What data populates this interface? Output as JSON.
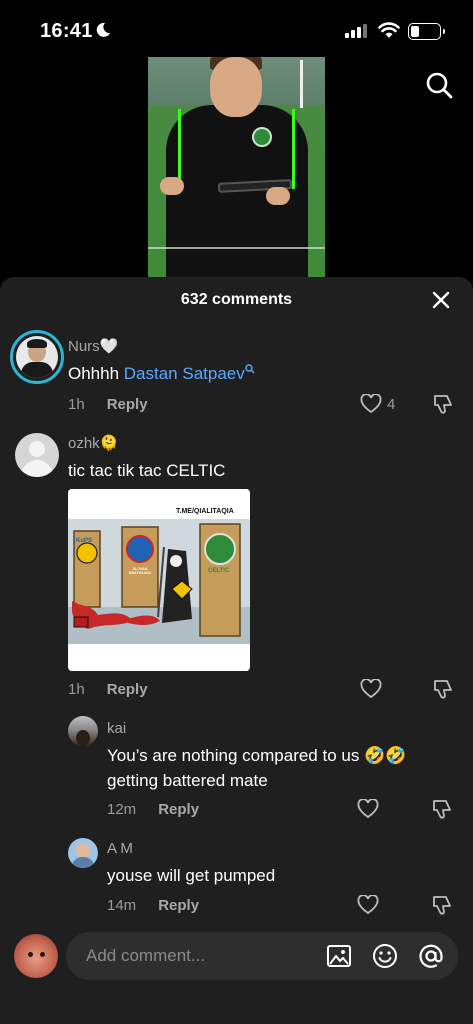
{
  "status_bar": {
    "time": "16:41",
    "battery_level": 0.3
  },
  "video": {
    "search_icon": "search-icon"
  },
  "comments_panel": {
    "title": "632 comments",
    "comments": [
      {
        "user": "Nurs🤍",
        "text_prefix": "Ohhhh ",
        "mention": "Dastan Satpaev",
        "time": "1h",
        "reply_label": "Reply",
        "likes": "4"
      },
      {
        "user": "ozhk🫠",
        "text": "tic tac tik tac CELTIC",
        "meme_caption": "T.ME/QIALITAQIA",
        "meme_door_labels": [
          "KuPS",
          "SLOVAN BRATISLAVA",
          "CELTIC"
        ],
        "time": "1h",
        "reply_label": "Reply"
      }
    ],
    "replies": [
      {
        "user": "kai",
        "text_line1": "You’s are nothing compared to us 🤣🤣",
        "text_line2": "getting battered mate",
        "time": "12m",
        "reply_label": "Reply"
      },
      {
        "user": "A M",
        "text": "youse will get pumped",
        "time": "14m",
        "reply_label": "Reply"
      }
    ]
  },
  "input": {
    "placeholder": "Add comment..."
  },
  "colors": {
    "accent_mention": "#5aa9ff",
    "sheet_bg": "#1f1f1f",
    "input_bg": "#2e2e2e"
  }
}
